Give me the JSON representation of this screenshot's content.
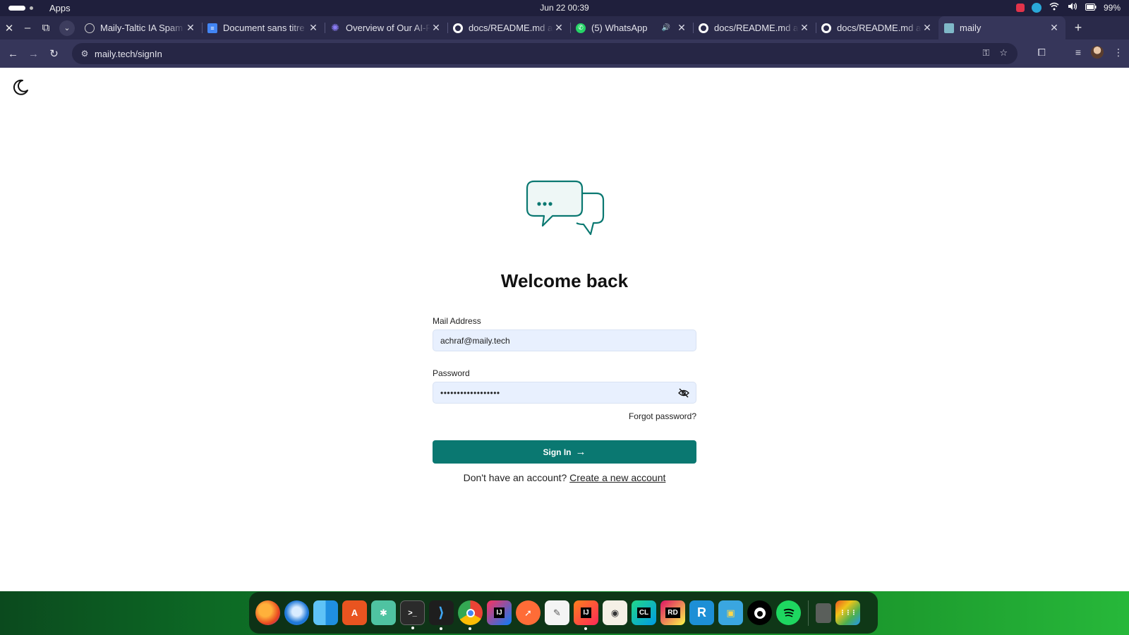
{
  "os": {
    "apps_label": "Apps",
    "clock": "Jun 22  00:39",
    "battery": "99%",
    "tray_icons": [
      "app-indicator-icon",
      "sync-icon",
      "wifi-icon",
      "volume-icon",
      "battery-icon"
    ]
  },
  "browser": {
    "tabs": [
      {
        "title": "Maily-Taltic IA Spam",
        "favicon": "globe-icon",
        "active": false
      },
      {
        "title": "Document sans titre",
        "favicon": "docs-icon",
        "active": false
      },
      {
        "title": "Overview of Our AI-P",
        "favicon": "gear-icon",
        "active": false
      },
      {
        "title": "docs/README.md at",
        "favicon": "github-icon",
        "active": false
      },
      {
        "title": "(5) WhatsApp",
        "favicon": "whatsapp-icon",
        "active": false,
        "audio": true
      },
      {
        "title": "docs/README.md at",
        "favicon": "github-icon",
        "active": false
      },
      {
        "title": "docs/README.md at",
        "favicon": "github-icon",
        "active": false
      },
      {
        "title": "maily",
        "favicon": "maily-icon",
        "active": true
      }
    ],
    "url": "maily.tech/signIn"
  },
  "page": {
    "title": "Welcome back",
    "email": {
      "label": "Mail Address",
      "value": "achraf@maily.tech"
    },
    "password": {
      "label": "Password",
      "masked_value": "••••••••••••••••••"
    },
    "forgot_label": "Forgot password?",
    "signin_label": "Sign In",
    "signup_prompt": "Don't have an account?",
    "signup_link": "Create a new account",
    "brand_color": "#0a7871"
  },
  "dock": {
    "apps": [
      {
        "name": "firefox",
        "glyph": ""
      },
      {
        "name": "thunderbird",
        "glyph": ""
      },
      {
        "name": "finder",
        "glyph": ""
      },
      {
        "name": "app-store",
        "glyph": "A"
      },
      {
        "name": "chatgpt",
        "glyph": "✱"
      },
      {
        "name": "terminal",
        "glyph": ">_"
      },
      {
        "name": "vscode",
        "glyph": "⟩"
      },
      {
        "name": "chrome",
        "glyph": ""
      },
      {
        "name": "intellij",
        "glyph": "IJ"
      },
      {
        "name": "postman",
        "glyph": "➚"
      },
      {
        "name": "text-editor",
        "glyph": "✎"
      },
      {
        "name": "intellij-alt",
        "glyph": "IJ"
      },
      {
        "name": "screenshot",
        "glyph": "◉"
      },
      {
        "name": "clion",
        "glyph": "CL"
      },
      {
        "name": "rider",
        "glyph": "RD"
      },
      {
        "name": "r-studio",
        "glyph": "R"
      },
      {
        "name": "image-viewer",
        "glyph": "▣"
      },
      {
        "name": "github-desktop",
        "glyph": ""
      },
      {
        "name": "spotify",
        "glyph": ""
      },
      {
        "name": "trash",
        "glyph": "🗑"
      },
      {
        "name": "show-apps",
        "glyph": "⋮⋮⋮"
      }
    ]
  }
}
